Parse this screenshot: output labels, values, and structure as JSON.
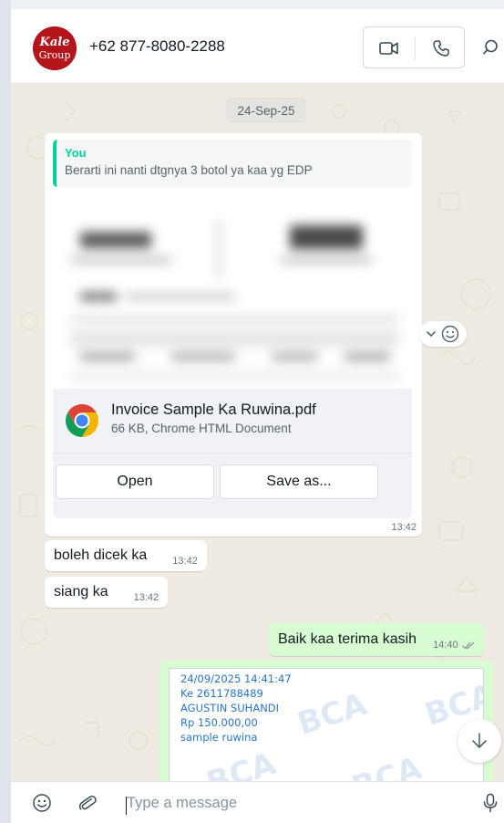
{
  "header": {
    "contact_name": "+62 877-8080-2288",
    "avatar_text": [
      "Kale",
      "Group"
    ],
    "video_icon": "video-camera-icon",
    "voice_icon": "phone-icon",
    "search_icon": "search-icon"
  },
  "chat": {
    "date_separator": "24-Sep-25",
    "quoted": {
      "author": "You",
      "text": "Berarti ini nanti dtgnya 3 botol ya kaa yg EDP"
    },
    "document": {
      "file_name": "Invoice Sample Ka Ruwina.pdf",
      "file_meta": "66 KB, Chrome HTML Document",
      "file_icon": "chrome-icon",
      "open_label": "Open",
      "save_label": "Save as...",
      "time": "13:42"
    },
    "messages": [
      {
        "text": "boleh dicek ka",
        "time": "13:42",
        "direction": "incoming"
      },
      {
        "text": "siang ka",
        "time": "13:42",
        "direction": "incoming"
      },
      {
        "text": "Baik kaa terima kasih",
        "time": "14:40",
        "direction": "outgoing",
        "status": "read"
      }
    ],
    "receipt": {
      "lines": [
        "24/09/2025 14:41:47",
        "Ke 2611788489",
        "AGUSTIN SUHANDI",
        "Rp 150.000,00",
        "sample ruwina"
      ],
      "watermark": "BCA"
    }
  },
  "composer": {
    "placeholder": "Type a message",
    "value": "",
    "emoji_icon": "smiley-icon",
    "attach_icon": "paperclip-icon",
    "mic_icon": "microphone-icon"
  },
  "colors": {
    "accent": "#06cf9c",
    "outgoing_bubble": "#d9fdd3",
    "chat_background": "#efeae2",
    "receipt_text": "#2a74c8"
  }
}
